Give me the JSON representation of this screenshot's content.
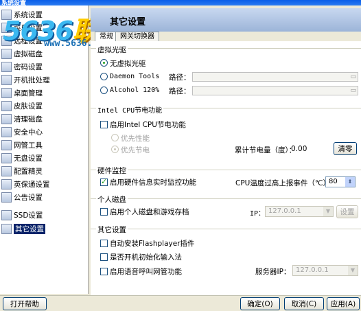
{
  "window": {
    "title": "系统设置"
  },
  "watermark": {
    "big_prefix": "5636",
    "big_suffix": "联盟",
    "url": "www.5636.com"
  },
  "sidebar": {
    "items": [
      {
        "label": "系统设置"
      },
      {
        "label": "菜单设置"
      },
      {
        "label": "远程设置"
      },
      {
        "label": "虚拟磁盘"
      },
      {
        "label": "密码设置"
      },
      {
        "label": "开机批处理"
      },
      {
        "label": "桌面管理"
      },
      {
        "label": "皮肤设置"
      },
      {
        "label": "清理磁盘"
      },
      {
        "label": "安全中心"
      },
      {
        "label": "网管工具"
      },
      {
        "label": "无盘设置"
      },
      {
        "label": "配置精灵"
      },
      {
        "label": "英保通设置"
      },
      {
        "label": "公告设置"
      },
      {
        "label": "SSD设置"
      },
      {
        "label": "其它设置"
      }
    ],
    "selected_index": 16
  },
  "header": {
    "title": "其它设置"
  },
  "tabs": [
    {
      "label": "常规"
    },
    {
      "label": "网关切换器"
    }
  ],
  "virtual_drive": {
    "title": "虚拟光驱",
    "opt_none": "无虚拟光驱",
    "opt_daemon": "Daemon Tools",
    "opt_alcohol": "Alcohol 120%",
    "path_label": "路径：",
    "selected": "无虚拟光驱"
  },
  "cpu_power": {
    "title": "Intel CPU节电功能",
    "enable_label": "启用Intel CPU节电功能",
    "enable_checked": false,
    "opt_performance": "优先性能",
    "opt_power": "优先节电",
    "selected": "优先节电",
    "accum_label": "累计节电量（度）：",
    "accum_value": "0.00",
    "clear_button": "清零"
  },
  "hardware_monitor": {
    "title": "硬件监控",
    "enable_label": "启用硬件信息实时监控功能",
    "enable_checked": true,
    "cpu_temp_label": "CPU温度过高上报事件（℃）：",
    "cpu_temp_value": "80"
  },
  "personal_disk": {
    "title": "个人磁盘",
    "enable_label": "启用个人磁盘和游戏存档",
    "enable_checked": false,
    "ip_label": "IP：",
    "ip_value": "127.0.0.1",
    "settings_button": "设置"
  },
  "other": {
    "title": "其它设置",
    "flash_label": "自动安装Flashplayer插件",
    "ime_label": "是否开机初始化输入法",
    "voice_label": "启用语音呼叫网管功能",
    "server_ip_label": "服务器IP：",
    "server_ip_value": "127.0.0.1"
  },
  "bottom": {
    "help_button": "打开帮助",
    "ok_button": "确定(O)",
    "cancel_button": "取消(C)",
    "apply_button": "应用(A)"
  }
}
